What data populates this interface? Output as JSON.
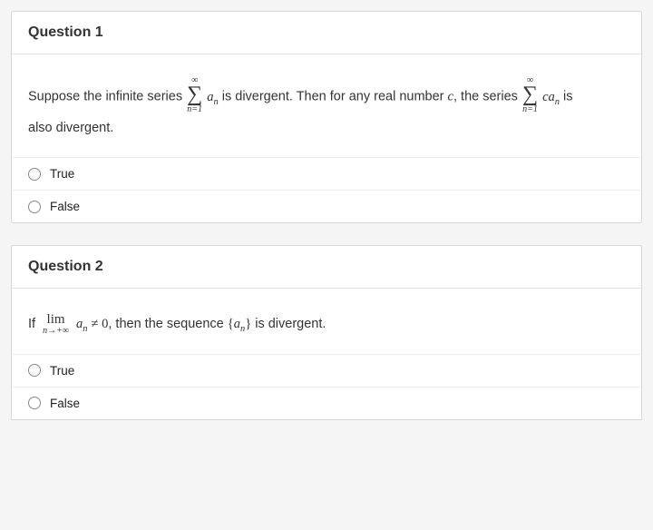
{
  "questions": [
    {
      "title": "Question 1",
      "statement": {
        "p1": "Suppose the infinite series",
        "sum1_top": "∞",
        "sum1_bot": "n=1",
        "sum1_term_a": "a",
        "sum1_term_sub": "n",
        "p2": "is divergent. Then for any real number",
        "c_var": "c",
        "p3": ", the series",
        "sum2_top": "∞",
        "sum2_bot": "n=1",
        "sum2_term_c": "c",
        "sum2_term_a": "a",
        "sum2_term_sub": "n",
        "p4": "is",
        "p5": "also divergent."
      },
      "options": [
        "True",
        "False"
      ]
    },
    {
      "title": "Question 2",
      "statement": {
        "p1": "If",
        "lim_label": "lim",
        "lim_sub": "n→+∞",
        "term_a": "a",
        "term_sub": "n",
        "neq": "≠ 0",
        "p2": ", then the sequence",
        "set_open": "{",
        "set_a": "a",
        "set_sub": "n",
        "set_close": "}",
        "p3": "is divergent."
      },
      "options": [
        "True",
        "False"
      ]
    }
  ]
}
